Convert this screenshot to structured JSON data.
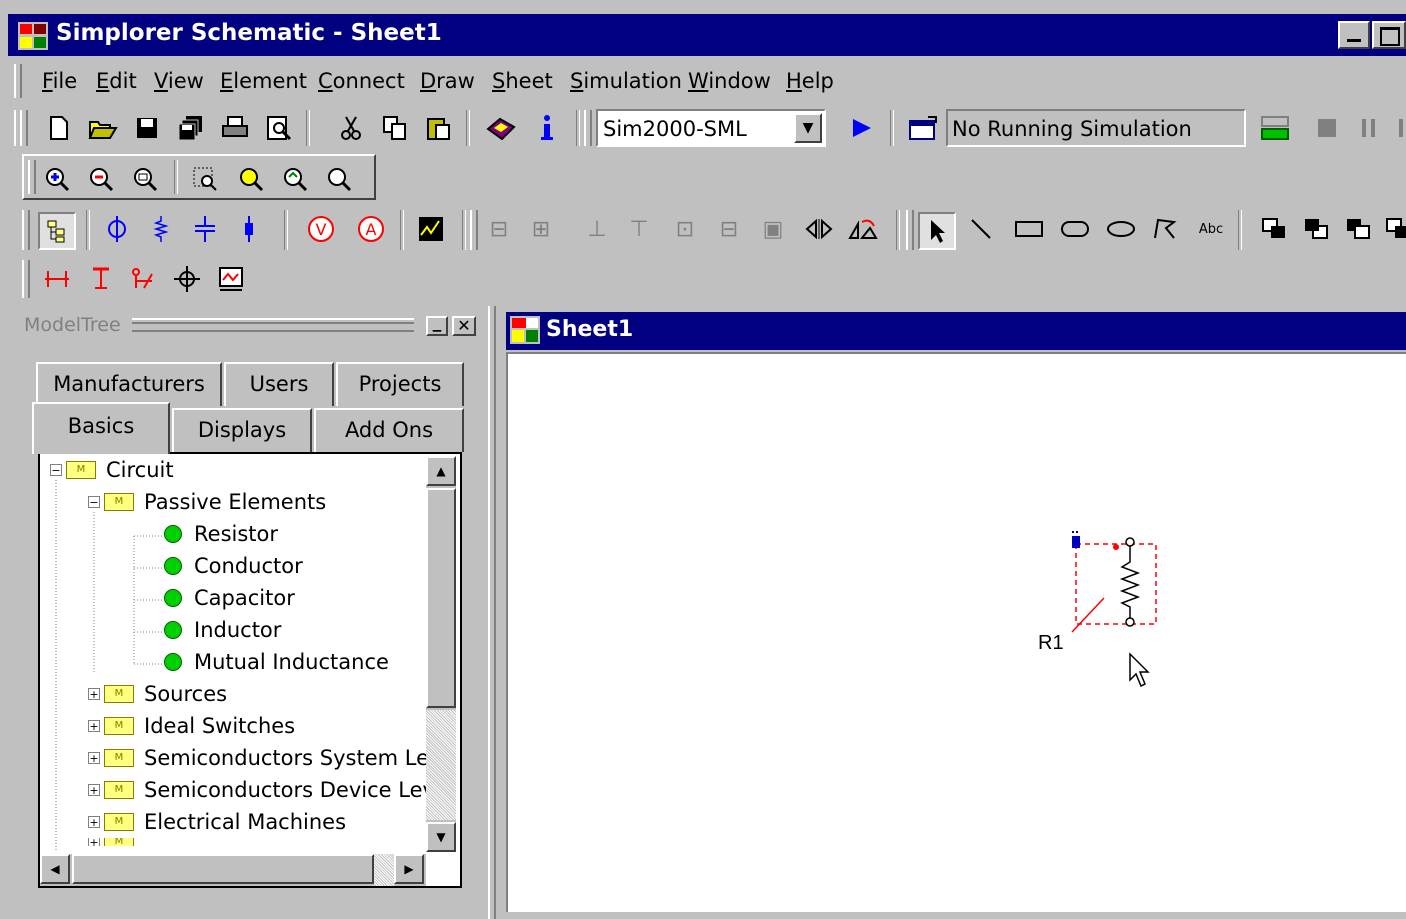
{
  "window": {
    "title": "Simplorer Schematic - Sheet1"
  },
  "menu": {
    "items": [
      "File",
      "Edit",
      "View",
      "Element",
      "Connect",
      "Draw",
      "Sheet",
      "Simulation",
      "Window",
      "Help"
    ],
    "underline": [
      "F",
      "E",
      "V",
      "E",
      "C",
      "D",
      "S",
      "S",
      "W",
      "H"
    ]
  },
  "toolbar": {
    "sim_profile": "Sim2000-SML",
    "sim_status": "No Running Simulation"
  },
  "modeltree": {
    "caption": "ModelTree",
    "tabs_back": [
      "Manufacturers",
      "Users",
      "Projects"
    ],
    "tabs_front": [
      "Basics",
      "Displays",
      "Add Ons"
    ],
    "active_tab": "Basics",
    "root": "Circuit",
    "group_open": "Passive Elements",
    "passive_items": [
      "Resistor",
      "Conductor",
      "Capacitor",
      "Inductor",
      "Mutual Inductance"
    ],
    "groups": [
      "Sources",
      "Ideal Switches",
      "Semiconductors System Lev",
      "Semiconductors Device Lev",
      "Electrical Machines"
    ],
    "colors": {
      "leaf_dot": "#00d000",
      "folder": "#ffff80"
    }
  },
  "sheet": {
    "title": "Sheet1",
    "component_label": "R1"
  },
  "colors": {
    "titlebar": "#000080",
    "face": "#c0c0c0",
    "selection": "#ff0000"
  }
}
